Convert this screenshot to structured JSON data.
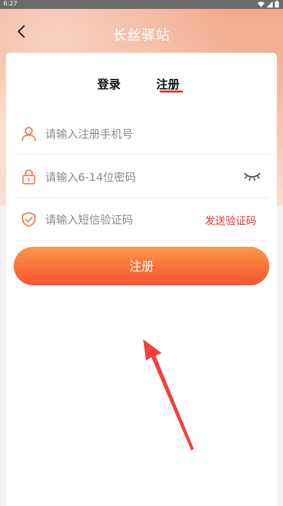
{
  "status_bar": {
    "time": "6:27"
  },
  "header": {
    "title": "长丝驿站"
  },
  "tabs": [
    {
      "label": "登录"
    },
    {
      "label": "注册"
    }
  ],
  "fields": {
    "phone": {
      "placeholder": "请输入注册手机号",
      "icon": "user-icon"
    },
    "password": {
      "placeholder": "请输入6-14位密码",
      "icon": "lock-icon",
      "toggle_icon": "eye-closed-icon"
    },
    "sms": {
      "placeholder": "请输入短信验证码",
      "icon": "shield-icon",
      "action_label": "发送验证码"
    }
  },
  "register_button": {
    "label": "注册"
  },
  "colors": {
    "accent": "#e7342b",
    "icon_orange": "#f07a4a",
    "button_top": "#fb9a4c",
    "button_bottom": "#f45634",
    "arrow_red": "#f2413a"
  }
}
